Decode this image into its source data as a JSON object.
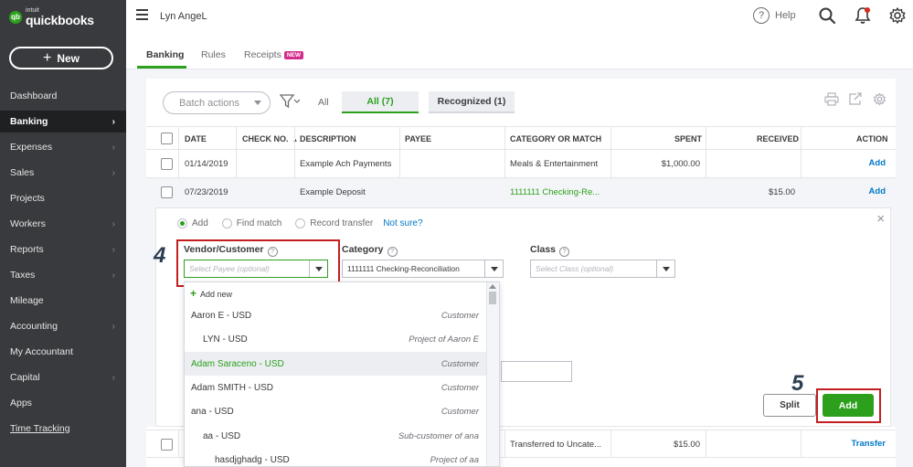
{
  "brand": {
    "intuit": "intuit",
    "name": "quickbooks"
  },
  "sidebar": {
    "new_label": "New",
    "items": [
      {
        "label": "Dashboard",
        "chevron": false
      },
      {
        "label": "Banking",
        "chevron": true
      },
      {
        "label": "Expenses",
        "chevron": true
      },
      {
        "label": "Sales",
        "chevron": true
      },
      {
        "label": "Projects",
        "chevron": false
      },
      {
        "label": "Workers",
        "chevron": true
      },
      {
        "label": "Reports",
        "chevron": true
      },
      {
        "label": "Taxes",
        "chevron": true
      },
      {
        "label": "Mileage",
        "chevron": false
      },
      {
        "label": "Accounting",
        "chevron": true
      },
      {
        "label": "My Accountant",
        "chevron": false
      },
      {
        "label": "Capital",
        "chevron": true
      },
      {
        "label": "Apps",
        "chevron": false
      },
      {
        "label": "Time Tracking",
        "chevron": false
      }
    ],
    "chevron_glyph": "›"
  },
  "topbar": {
    "company": "Lyn AngeL",
    "help": "Help",
    "help_glyph": "?"
  },
  "tabs": {
    "banking": "Banking",
    "rules": "Rules",
    "receipts": "Receipts",
    "new_badge": "NEW"
  },
  "toolbar": {
    "batch_actions": "Batch actions",
    "all_label": "All",
    "seg_all": "All (7)",
    "seg_recognized": "Recognized (1)"
  },
  "table": {
    "headers": {
      "date": "DATE",
      "check": "CHECK NO.",
      "sort": "▲",
      "desc": "DESCRIPTION",
      "payee": "PAYEE",
      "category": "CATEGORY OR MATCH",
      "spent": "SPENT",
      "received": "RECEIVED",
      "action": "ACTION"
    },
    "rows": [
      {
        "date": "01/14/2019",
        "desc": "Example Ach Payments",
        "category": "Meals & Entertainment",
        "spent": "$1,000.00",
        "received": "",
        "action": "Add"
      },
      {
        "date": "07/23/2019",
        "desc": "Example Deposit",
        "category": "1111111 Checking-Re...",
        "spent": "",
        "received": "$15.00",
        "action": "Add"
      },
      {
        "date": "",
        "desc": "",
        "category": "Transferred to Uncate...",
        "spent": "$15.00",
        "received": "",
        "action": "Transfer"
      }
    ]
  },
  "form": {
    "radio_add": "Add",
    "radio_find": "Find match",
    "radio_transfer": "Record transfer",
    "not_sure": "Not sure?",
    "close": "×",
    "vendor_label": "Vendor/Customer",
    "vendor_placeholder": "Select Payee (optional)",
    "category_label": "Category",
    "category_value": "1111111 Checking-Reconciliation",
    "class_label": "Class",
    "class_placeholder": "Select Class (optional)",
    "info_glyph": "?",
    "split": "Split",
    "add": "Add"
  },
  "dropdown": {
    "add_new": "Add new",
    "items": [
      {
        "name": "Aaron E - USD",
        "type": "Customer",
        "indent": 0,
        "highlight": false
      },
      {
        "name": "LYN - USD",
        "type": "Project of Aaron E",
        "indent": 1,
        "highlight": false
      },
      {
        "name": "Adam Saraceno - USD",
        "type": "Customer",
        "indent": 0,
        "highlight": true
      },
      {
        "name": "Adam SMITH - USD",
        "type": "Customer",
        "indent": 0,
        "highlight": false
      },
      {
        "name": "ana - USD",
        "type": "Customer",
        "indent": 0,
        "highlight": false
      },
      {
        "name": "aa - USD",
        "type": "Sub-customer of ana",
        "indent": 1,
        "highlight": false
      },
      {
        "name": "hasdjghadg - USD",
        "type": "Project of aa",
        "indent": 2,
        "highlight": false
      }
    ]
  },
  "steps": {
    "four": "4",
    "five": "5"
  },
  "colors": {
    "green": "#2ca01c",
    "blue": "#0077c5",
    "red_box": "#c21e1e",
    "sidebar": "#393a3d"
  }
}
